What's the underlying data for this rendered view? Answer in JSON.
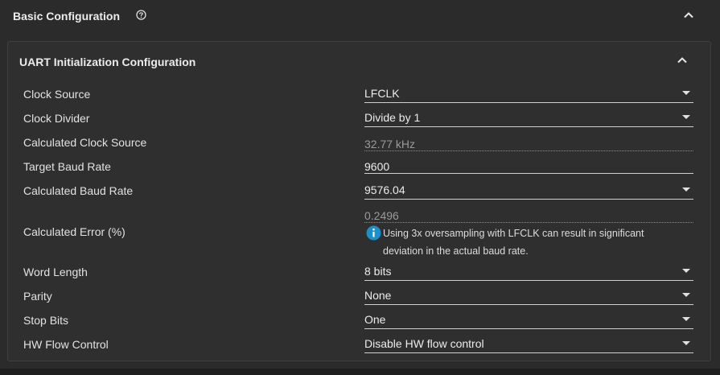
{
  "basic": {
    "title": "Basic Configuration",
    "help_icon": "help-circle-icon",
    "collapse_icon": "chevron-up-icon"
  },
  "uart": {
    "title": "UART Initialization Configuration",
    "collapse_icon": "chevron-up-icon"
  },
  "rows": {
    "clock_source": {
      "label": "Clock Source",
      "value": "LFCLK"
    },
    "clock_divider": {
      "label": "Clock Divider",
      "value": "Divide by 1"
    },
    "calc_clock_source": {
      "label": "Calculated Clock Source",
      "value": "32.77 kHz"
    },
    "target_baud": {
      "label": "Target Baud Rate",
      "value": "9600"
    },
    "calc_baud": {
      "label": "Calculated Baud Rate",
      "value": "9576.04"
    },
    "calc_error": {
      "label": "Calculated Error (%)",
      "value": "0.2496",
      "info_icon": "info-icon",
      "info_line1": "Using 3x oversampling with LFCLK can result in significant",
      "info_line2": "deviation in the actual baud rate."
    },
    "word_length": {
      "label": "Word Length",
      "value": "8 bits"
    },
    "parity": {
      "label": "Parity",
      "value": "None"
    },
    "stop_bits": {
      "label": "Stop Bits",
      "value": "One"
    },
    "hw_flow": {
      "label": "HW Flow Control",
      "value": "Disable HW flow control"
    }
  },
  "colors": {
    "background": "#2b2b2b",
    "panel": "#2f2f2f",
    "info_blue": "#1b8fc9",
    "text": "#e2e2e2",
    "muted_text": "#9a9a9a"
  }
}
